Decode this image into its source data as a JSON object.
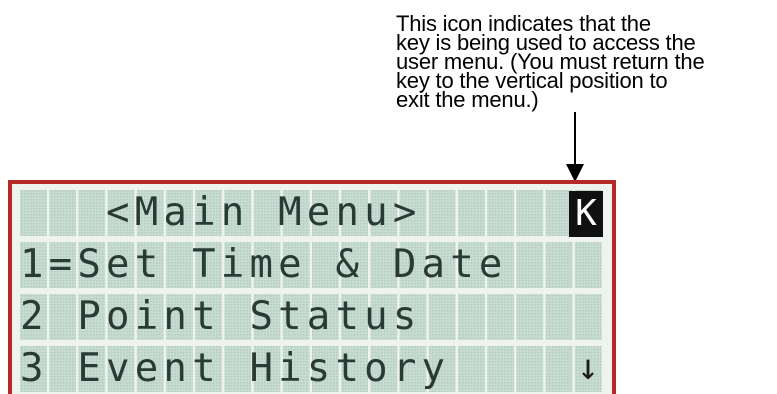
{
  "callout": {
    "lines": [
      "This icon indicates that the",
      "key is being used to access the",
      "user menu. (You must return the",
      "key to the vertical position to",
      "exit the menu.)"
    ]
  },
  "display": {
    "rows": [
      "   <Main Menu>",
      "1=Set Time & Date",
      "2 Point Status",
      "3 Event History"
    ],
    "key_icon": "K",
    "scroll_indicator": "↓"
  },
  "colors": {
    "frame": "#b52a24",
    "lcd_background": "#c7dcd2",
    "lcd_cell": "#b6cfc3",
    "lcd_text": "#2a3a34",
    "key_icon_background": "#101010"
  }
}
